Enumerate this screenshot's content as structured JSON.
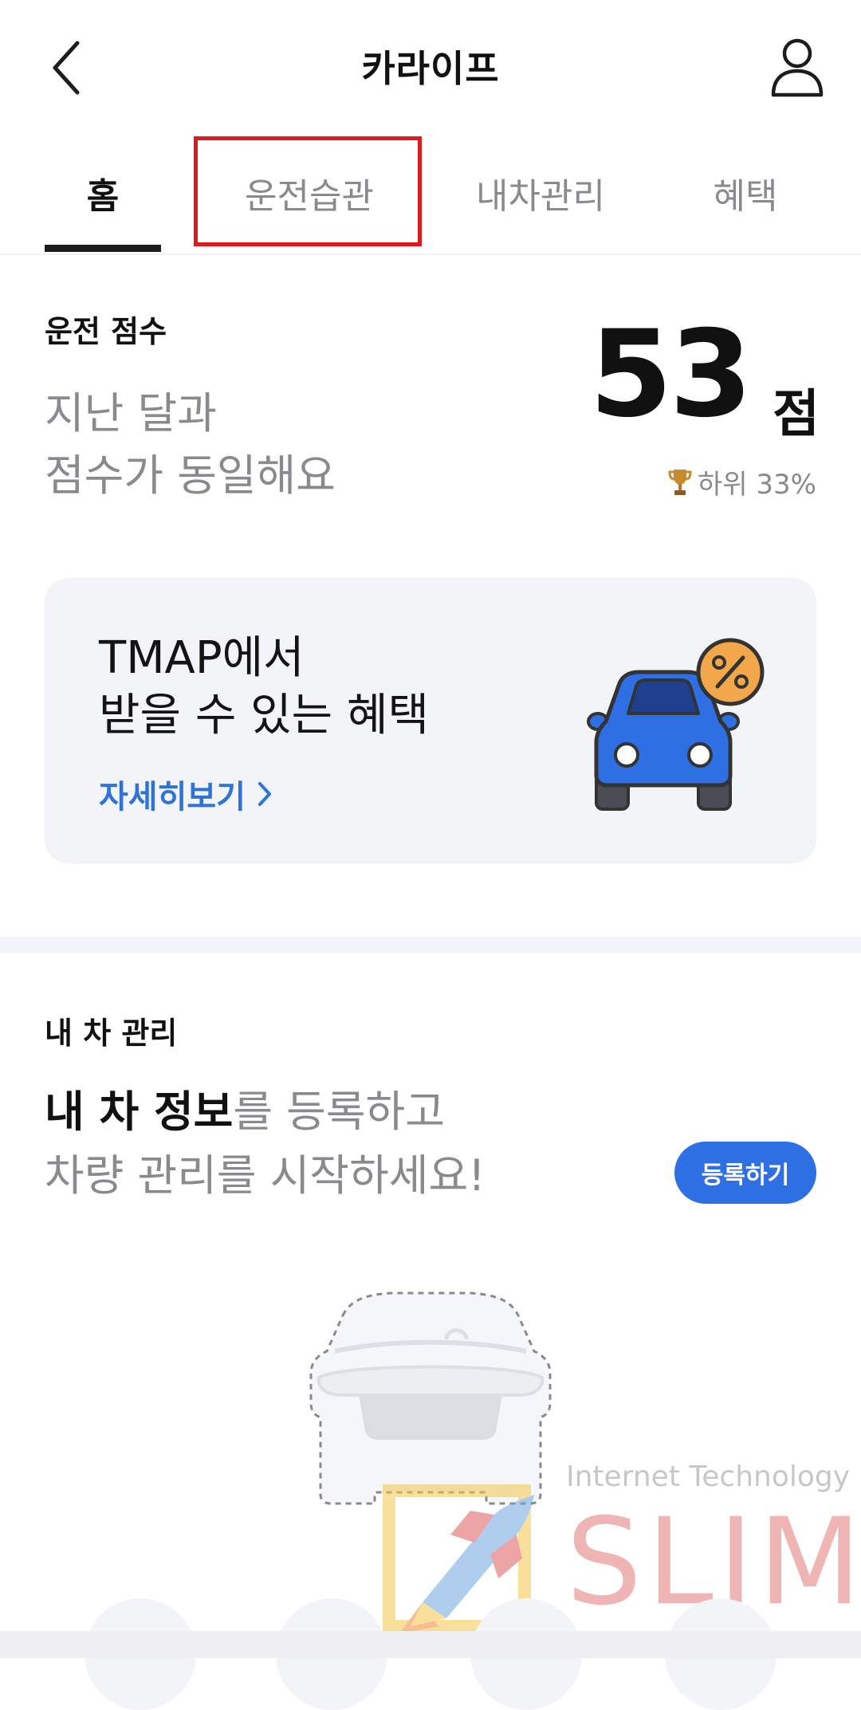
{
  "header": {
    "title": "카라이프",
    "back_icon": "chevron-left-icon",
    "profile_icon": "user-icon"
  },
  "tabs": [
    {
      "label": "홈",
      "active": true
    },
    {
      "label": "운전습관",
      "active": false,
      "highlighted": true
    },
    {
      "label": "내차관리",
      "active": false
    },
    {
      "label": "혜택",
      "active": false
    }
  ],
  "score": {
    "label": "운전 점수",
    "message_line1": "지난 달과",
    "message_line2": "점수가 동일해요",
    "value": "53",
    "unit": "점",
    "rank": "하위 33%",
    "rank_icon": "trophy-icon"
  },
  "benefit": {
    "title_line1": "TMAP에서",
    "title_line2": "받을 수 있는 혜택",
    "link_label": "자세히보기",
    "illustration": "car-discount-icon"
  },
  "mycar": {
    "label": "내 차 관리",
    "message_strong": "내 차 정보",
    "message_rest": "를 등록하고",
    "message_line2": "차량 관리를 시작하세요!",
    "register_label": "등록하기"
  },
  "watermark": {
    "caption": "Internet Technology",
    "word": "SLIM"
  },
  "colors": {
    "accent_blue": "#2f6fe4",
    "link_blue": "#2f73d6",
    "highlight_red": "#e0191e",
    "muted_text": "#8a8a8e",
    "card_bg": "#f3f4f8"
  }
}
